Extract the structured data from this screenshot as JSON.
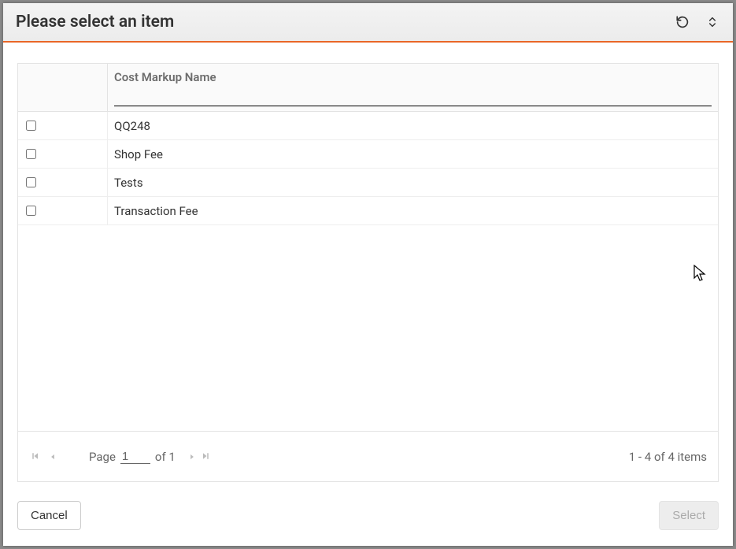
{
  "header": {
    "title": "Please select an item"
  },
  "grid": {
    "columns": {
      "name_label": "Cost Markup Name"
    },
    "filter": {
      "value": ""
    },
    "rows": [
      {
        "name": "QQ248"
      },
      {
        "name": "Shop Fee"
      },
      {
        "name": "Tests"
      },
      {
        "name": "Transaction Fee"
      }
    ]
  },
  "pager": {
    "page_label": "Page",
    "page_value": "1",
    "of_label": "of 1",
    "info": "1 - 4 of 4 items"
  },
  "footer": {
    "cancel_label": "Cancel",
    "select_label": "Select"
  }
}
